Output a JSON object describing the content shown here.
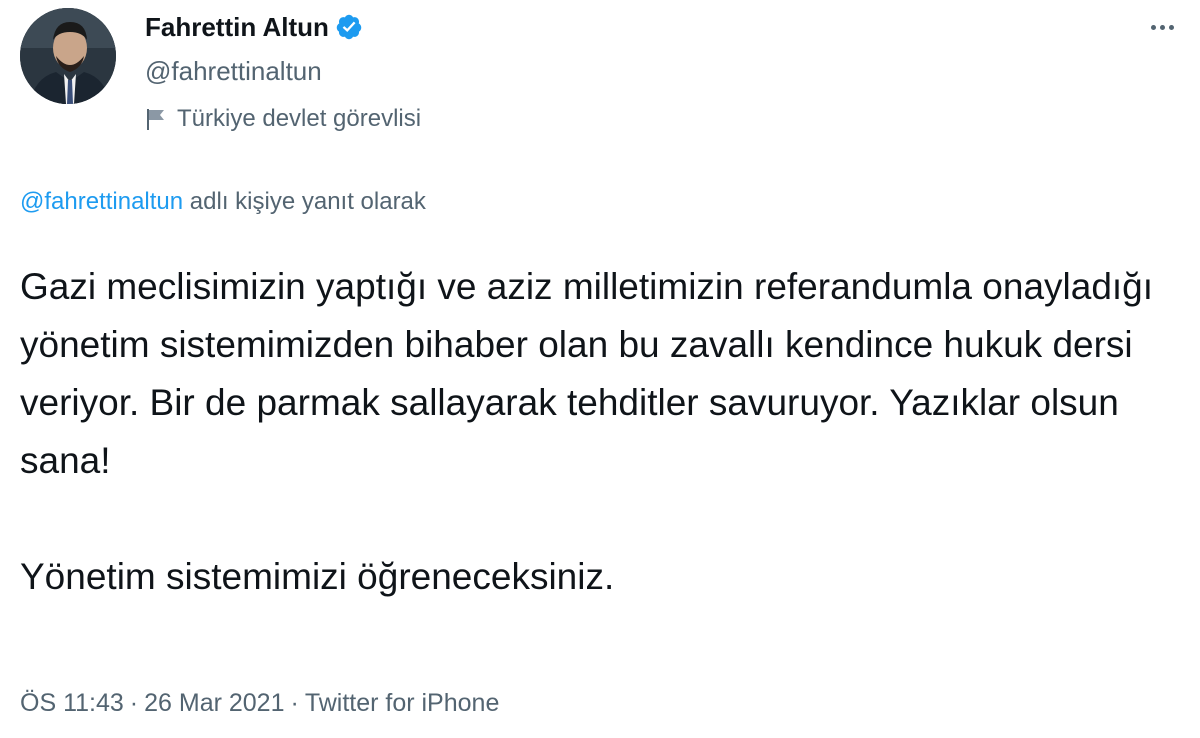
{
  "author": {
    "display_name": "Fahrettin Altun",
    "handle": "@fahrettinaltun",
    "verified": true,
    "label": "Türkiye devlet görevlisi",
    "avatar_icon": "person-avatar",
    "label_icon": "flag-icon"
  },
  "reply": {
    "mention": "@fahrettinaltun",
    "suffix": "adlı kişiye yanıt olarak"
  },
  "tweet": {
    "paragraphs": [
      "Gazi meclisimizin yaptığı ve aziz milletimizin referandumla onayladığı yönetim sistemimizden bihaber olan bu zavallı kendince hukuk dersi veriyor. Bir de parmak sallayarak tehditler savuruyor. Yazıklar olsun sana!",
      "Yönetim sistemimizi öğreneceksiniz."
    ]
  },
  "meta": {
    "time": "ÖS 11:43",
    "date": "26 Mar 2021",
    "source": "Twitter for iPhone",
    "separator": "·"
  },
  "colors": {
    "text": "#0f1419",
    "secondary": "#536471",
    "link": "#1d9bf0",
    "verified_badge": "#1d9bf0"
  }
}
